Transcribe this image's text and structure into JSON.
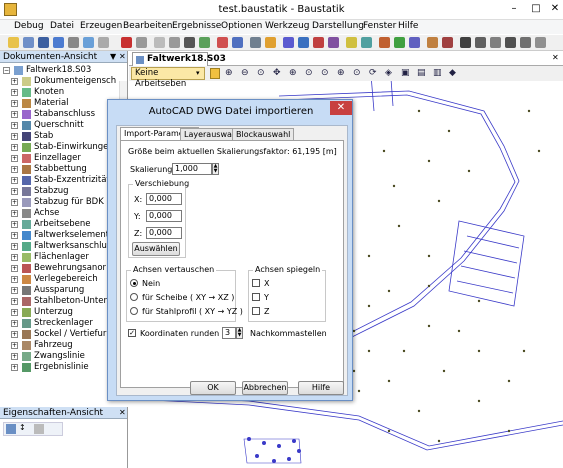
{
  "window": {
    "title": "test.baustatik - Baustatik"
  },
  "menu": [
    "Debug",
    "Datei",
    "Erzeugen",
    "Bearbeiten",
    "Ergebnisse",
    "Optionen",
    "Werkzeug",
    "Darstellung",
    "Fenster",
    "Hilfe"
  ],
  "left_panel": {
    "header": "Dokumenten-Ansicht",
    "root": "Faltwerk18.S03",
    "items": [
      "Dokumenteigensch",
      "Knoten",
      "Material",
      "Stabanschluss",
      "Querschnitt",
      "Stab",
      "Stab-Einwirkungen",
      "Einzellager",
      "Stabbettung",
      "Stab-Exzentrizität",
      "Stabzug",
      "Stabzug für BDK",
      "Achse",
      "Arbeitsebene",
      "Faltwerkselement",
      "Faltwerksanschlu",
      "Flächenlager",
      "Bewehrungsanor",
      "Verlegebereich",
      "Aussparung",
      "Stahlbeton-Unter",
      "Unterzug",
      "Streckenlager",
      "Sockel / Vertiefur",
      "Fahrzeug",
      "Zwangslinie",
      "Ergebnislinie"
    ]
  },
  "properties_panel": {
    "header": "Eigenschaften-Ansicht"
  },
  "document_tab": "Faltwerk18.S03",
  "workplane_label": "Keine Arbeitseben",
  "dialog": {
    "title": "AutoCAD DWG Datei importieren",
    "tabs": [
      "Import-Parameter",
      "Layerauswahl",
      "Blockauswahl"
    ],
    "scale_info": "Größe beim aktuellen Skalierungsfaktor: 61,195 [m]",
    "scale_label": "Skalierung:",
    "scale_value": "1,000",
    "offset_group": "Verschiebung",
    "x_label": "X:",
    "x_value": "0,000",
    "y_label": "Y:",
    "y_value": "0,000",
    "z_label": "Z:",
    "z_value": "0,000",
    "select_button": "Auswählen",
    "swap_group": "Achsen vertauschen",
    "swap_options": [
      "Nein",
      "für Scheibe ( XY → XZ )",
      "für Stahlprofil ( XY → YZ )"
    ],
    "mirror_group": "Achsen spiegeln",
    "mirror_options": [
      "X",
      "Y",
      "Z"
    ],
    "round_label": "Koordinaten runden auf",
    "round_value": "3",
    "round_suffix": "Nachkommastellen",
    "ok": "OK",
    "cancel": "Abbrechen",
    "help": "Hilfe"
  },
  "colors": {
    "accent": "#3a3ac8",
    "node": "#4a4a20",
    "panel_header": "#cfe0f4",
    "dialog_frame": "#c7dcf5"
  }
}
